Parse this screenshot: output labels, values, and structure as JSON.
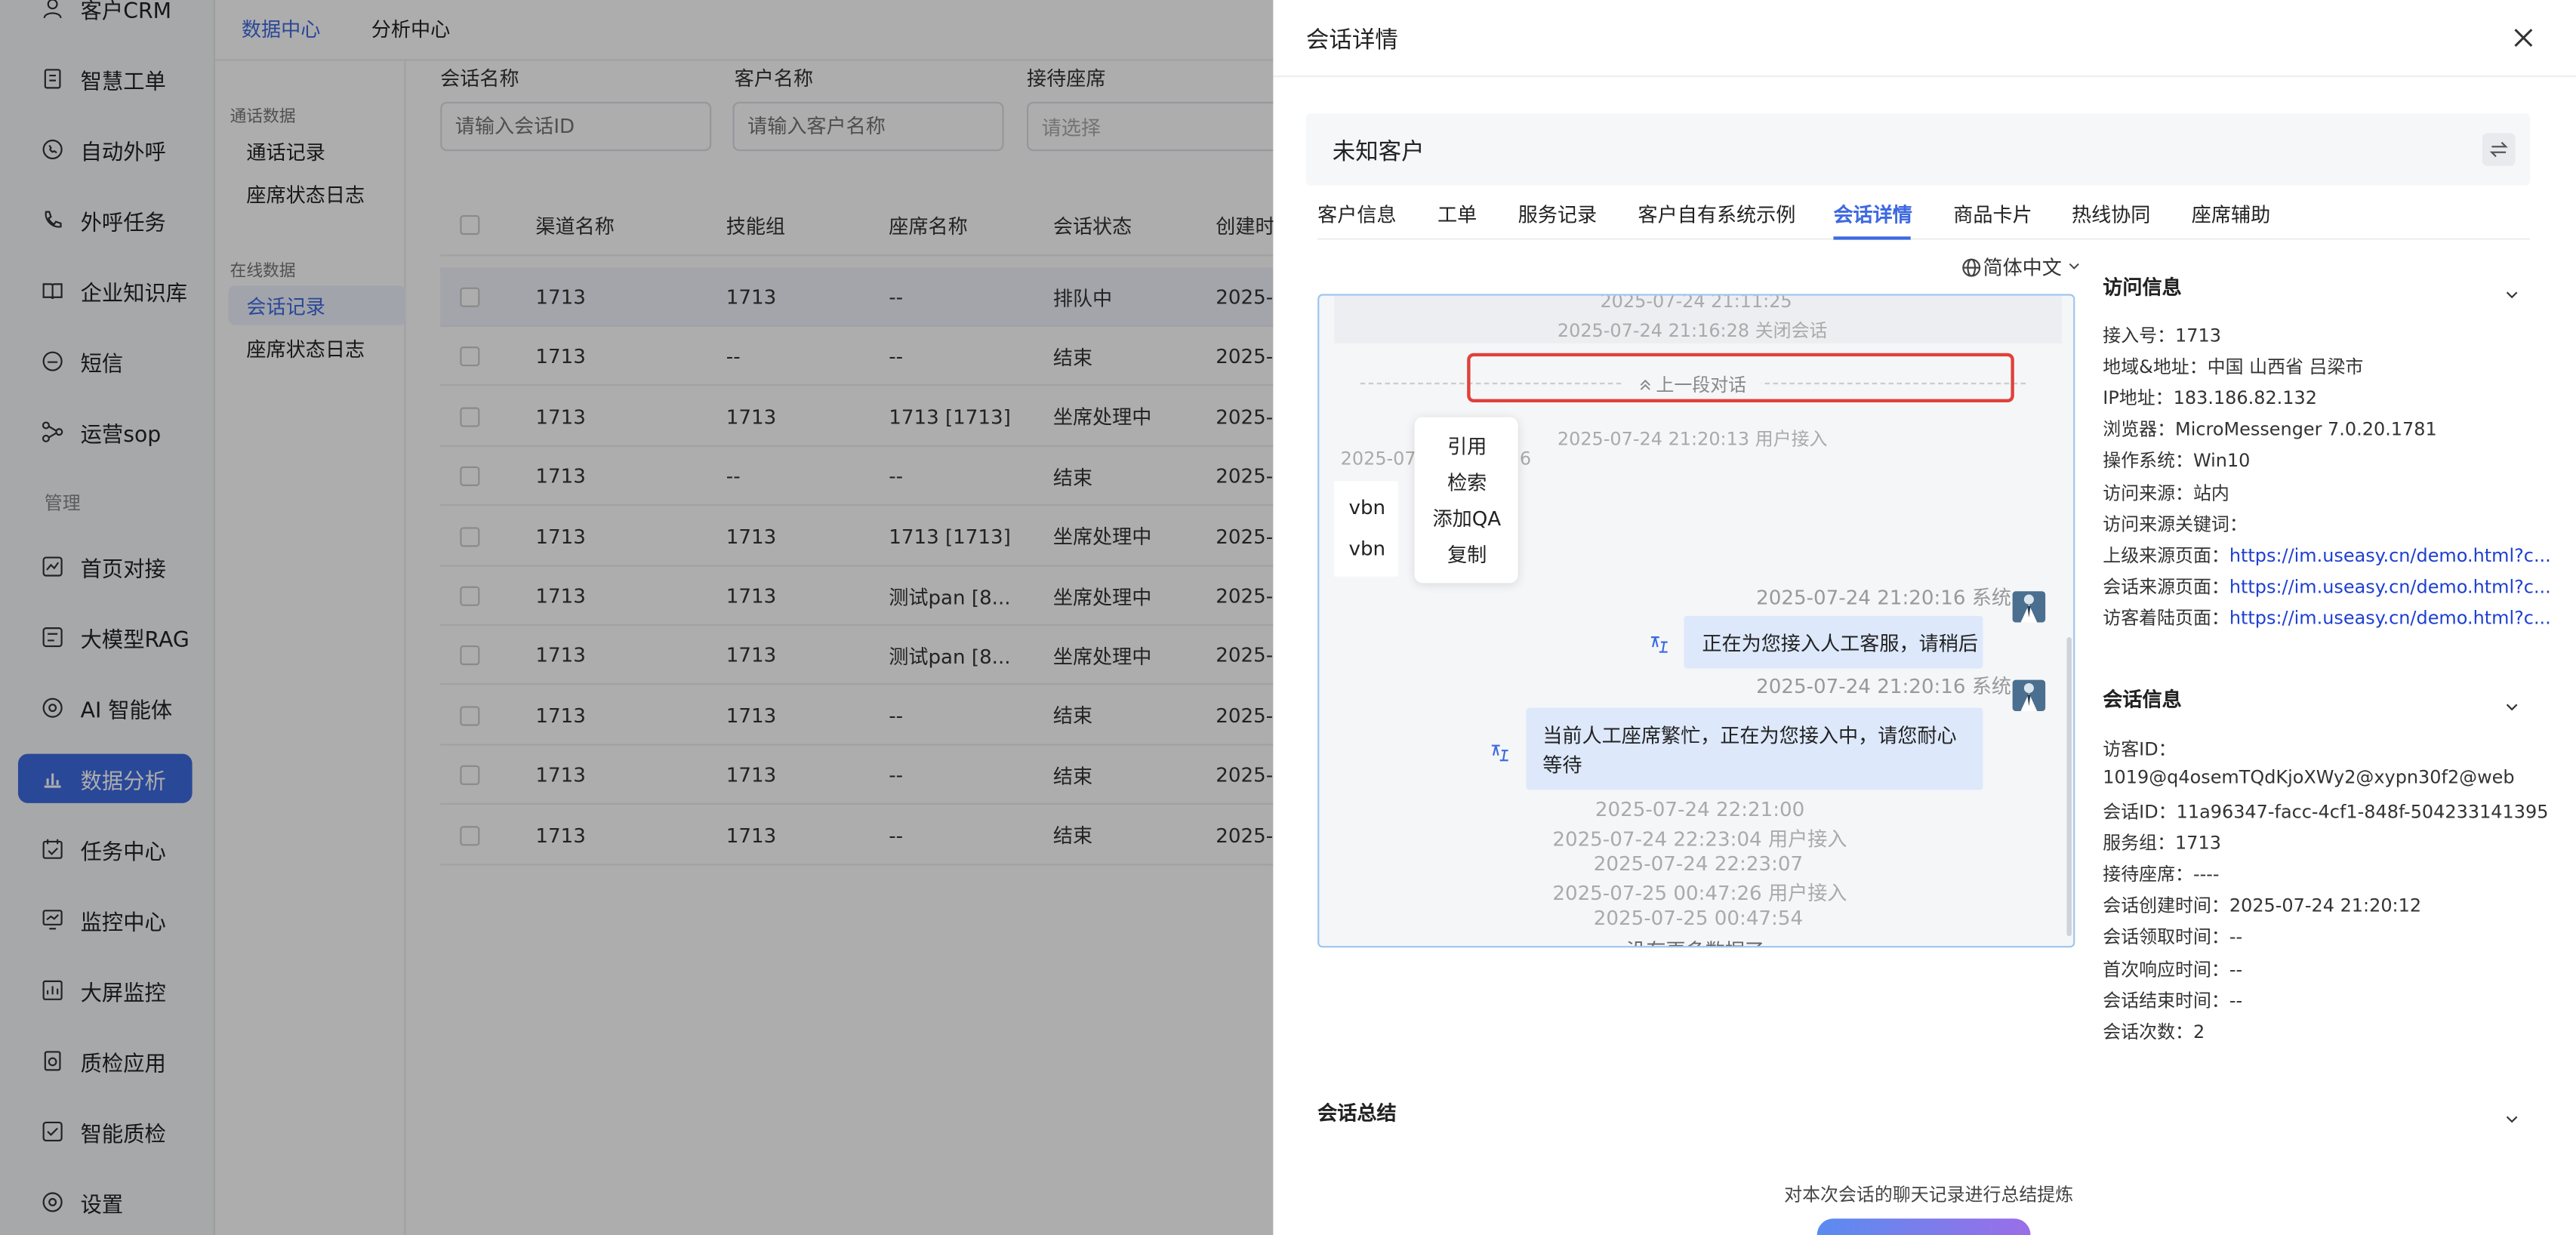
{
  "sidebar": {
    "items": [
      {
        "label": "客户CRM",
        "icon": "user-icon"
      },
      {
        "label": "智慧工单",
        "icon": "document-icon"
      },
      {
        "label": "自动外呼",
        "icon": "phone-icon"
      },
      {
        "label": "外呼任务",
        "icon": "phone-task-icon"
      },
      {
        "label": "企业知识库",
        "icon": "book-icon"
      },
      {
        "label": "短信",
        "icon": "sms-icon"
      },
      {
        "label": "运营sop",
        "icon": "flow-icon"
      },
      {
        "label": "首页对接",
        "icon": "chart-icon"
      },
      {
        "label": "大模型RAG",
        "icon": "grid-icon"
      },
      {
        "label": "AI 智能体",
        "icon": "ai-icon"
      },
      {
        "label": "数据分析",
        "icon": "bar-chart-icon"
      },
      {
        "label": "任务中心",
        "icon": "calendar-icon"
      },
      {
        "label": "监控中心",
        "icon": "monitor-icon"
      },
      {
        "label": "大屏监控",
        "icon": "screen-icon"
      },
      {
        "label": "质检应用",
        "icon": "check-doc-icon"
      },
      {
        "label": "智能质检",
        "icon": "smart-check-icon"
      },
      {
        "label": "设置",
        "icon": "gear-icon"
      }
    ],
    "section_manage": "管理"
  },
  "top_tabs": [
    "数据中心",
    "分析中心"
  ],
  "subnav": {
    "section1": "通话数据",
    "section1_items": [
      "通话记录",
      "座席状态日志"
    ],
    "section2": "在线数据",
    "section2_items": [
      "会话记录",
      "座席状态日志"
    ]
  },
  "filters": {
    "session_name_label": "会话名称",
    "session_name_placeholder": "请输入会话ID",
    "customer_name_label": "客户名称",
    "customer_name_placeholder": "请输入客户名称",
    "agent_label": "接待座席",
    "agent_placeholder": "请选择"
  },
  "table": {
    "headers": [
      "渠道名称",
      "技能组",
      "座席名称",
      "会话状态",
      "创建时"
    ],
    "rows": [
      [
        "1713",
        "1713",
        "--",
        "排队中",
        "2025-"
      ],
      [
        "1713",
        "--",
        "--",
        "结束",
        "2025-"
      ],
      [
        "1713",
        "1713",
        "1713 [1713]",
        "坐席处理中",
        "2025-"
      ],
      [
        "1713",
        "--",
        "--",
        "结束",
        "2025-"
      ],
      [
        "1713",
        "1713",
        "1713 [1713]",
        "坐席处理中",
        "2025-"
      ],
      [
        "1713",
        "1713",
        "测试pan [8...",
        "坐席处理中",
        "2025-"
      ],
      [
        "1713",
        "1713",
        "测试pan [8...",
        "坐席处理中",
        "2025-"
      ],
      [
        "1713",
        "1713",
        "--",
        "结束",
        "2025-"
      ],
      [
        "1713",
        "1713",
        "--",
        "结束",
        "2025-"
      ],
      [
        "1713",
        "1713",
        "--",
        "结束",
        "2025-"
      ]
    ]
  },
  "drawer": {
    "title": "会话详情",
    "customer": "未知客户",
    "tabs": [
      "客户信息",
      "工单",
      "服务记录",
      "客户自有系统示例",
      "会话详情",
      "商品卡片",
      "热线协同",
      "座席辅助"
    ],
    "language": "简体中文",
    "chat": {
      "t1": "2025-07-24 21:11:25",
      "t2": "2025-07-24 21:16:28 关闭会话",
      "prev_label": "上一段对话",
      "t3": "2025-07-24 21:20:13 用户接入",
      "user_time_partial_a": "2025-07",
      "user_time_partial_b": "6",
      "user_msgs": [
        "vbn",
        "vbn"
      ],
      "context_menu": [
        "引用",
        "检索",
        "添加QA",
        "复制"
      ],
      "sys_time_1": "2025-07-24 21:20:16 系统",
      "sys_msg_1": "正在为您接入人工客服，请稍后",
      "sys_time_2": "2025-07-24 21:20:16 系统",
      "sys_msg_2": "当前人工座席繁忙，正在为您接入中，请您耐心等待",
      "tail": [
        "2025-07-24 22:21:00",
        "2025-07-24 22:23:04 用户接入",
        "2025-07-24 22:23:07",
        "2025-07-25 00:47:26 用户接入",
        "2025-07-25 00:47:54",
        "没有更多数据了"
      ]
    },
    "visit_info": {
      "title": "访问信息",
      "rows": [
        {
          "label": "接入号：",
          "value": "1713"
        },
        {
          "label": "地域&地址：",
          "value": "中国 山西省 吕梁市"
        },
        {
          "label": "IP地址：",
          "value": "183.186.82.132"
        },
        {
          "label": "浏览器：",
          "value": "MicroMessenger 7.0.20.1781"
        },
        {
          "label": "操作系统：",
          "value": "Win10"
        },
        {
          "label": "访问来源：",
          "value": "站内"
        },
        {
          "label": "访问来源关键词：",
          "value": ""
        },
        {
          "label": "上级来源页面：",
          "link": "https://im.useasy.cn/demo.html?c..."
        },
        {
          "label": "会话来源页面：",
          "link": "https://im.useasy.cn/demo.html?c..."
        },
        {
          "label": "访客着陆页面：",
          "link": "https://im.useasy.cn/demo.html?c..."
        }
      ]
    },
    "session_info": {
      "title": "会话信息",
      "visitor_id_label": "访客ID：",
      "visitor_id": "1019@q4osemTQdKjoXWy2@xypn30f2@web",
      "rows": [
        {
          "label": "会话ID：",
          "value": "11a96347-facc-4cf1-848f-504233141395"
        },
        {
          "label": "服务组：",
          "value": "1713"
        },
        {
          "label": "接待座席：",
          "value": "----"
        },
        {
          "label": "会话创建时间：",
          "value": "2025-07-24 21:20:12"
        },
        {
          "label": "会话领取时间：",
          "value": "--"
        },
        {
          "label": "首次响应时间：",
          "value": "--"
        },
        {
          "label": "会话结束时间：",
          "value": "--"
        },
        {
          "label": "会话次数：",
          "value": "2"
        }
      ]
    },
    "summary_title": "会话总结",
    "summary_desc": "对本次会话的聊天记录进行总结提炼"
  },
  "colors": {
    "accent": "#3e6ae1",
    "highlight_box": "#e0413a",
    "link": "#1e3fd1"
  }
}
